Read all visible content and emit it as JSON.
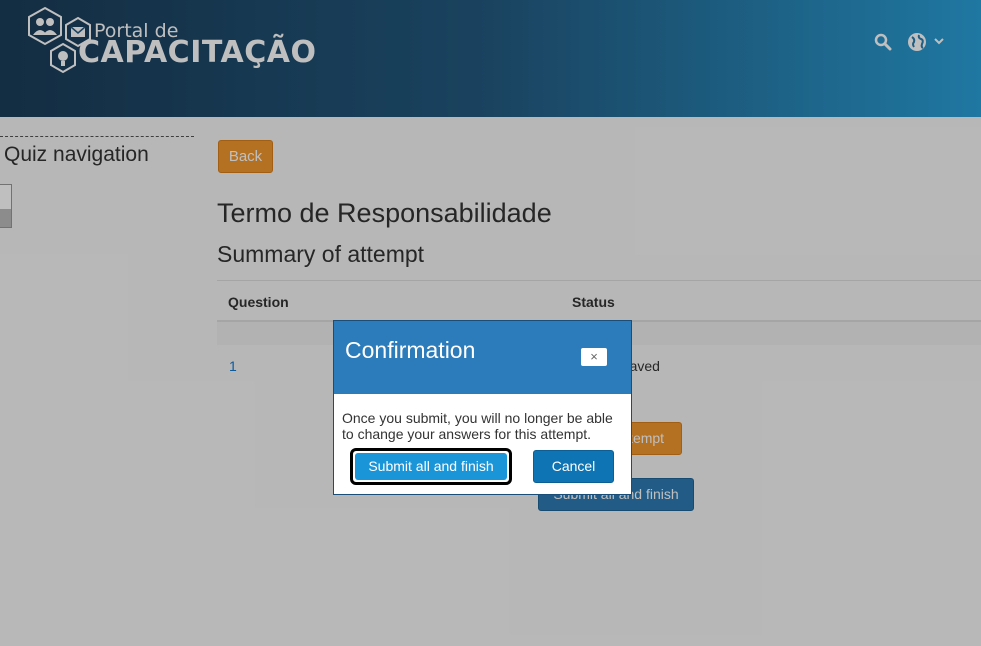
{
  "header": {
    "logo_small": "Portal de",
    "logo_big": "CAPACITAÇÃO",
    "icons": [
      "search-icon",
      "globe-icon",
      "chevron-down-icon"
    ]
  },
  "sidebar": {
    "title": "Quiz navigation"
  },
  "main": {
    "back_label": "Back",
    "page_title": "Termo de Responsabilidade",
    "section_title": "Summary of attempt",
    "table": {
      "columns": [
        "Question",
        "Status"
      ],
      "rows": [
        {
          "question": "1",
          "status": "Answer saved"
        }
      ]
    },
    "return_label": "Return to attempt",
    "submit_label": "Submit all and finish"
  },
  "dialog": {
    "title": "Confirmation",
    "close_label": "×",
    "message": "Once you submit, you will no longer be able to change your answers for this attempt.",
    "submit_label": "Submit all and finish",
    "cancel_label": "Cancel"
  },
  "colors": {
    "header_gradient_start": "#1a3c58",
    "header_gradient_end": "#2aa0d8",
    "orange_button": "#f0972e",
    "blue_button": "#2e7bb3",
    "dialog_header": "#2c7bba"
  }
}
